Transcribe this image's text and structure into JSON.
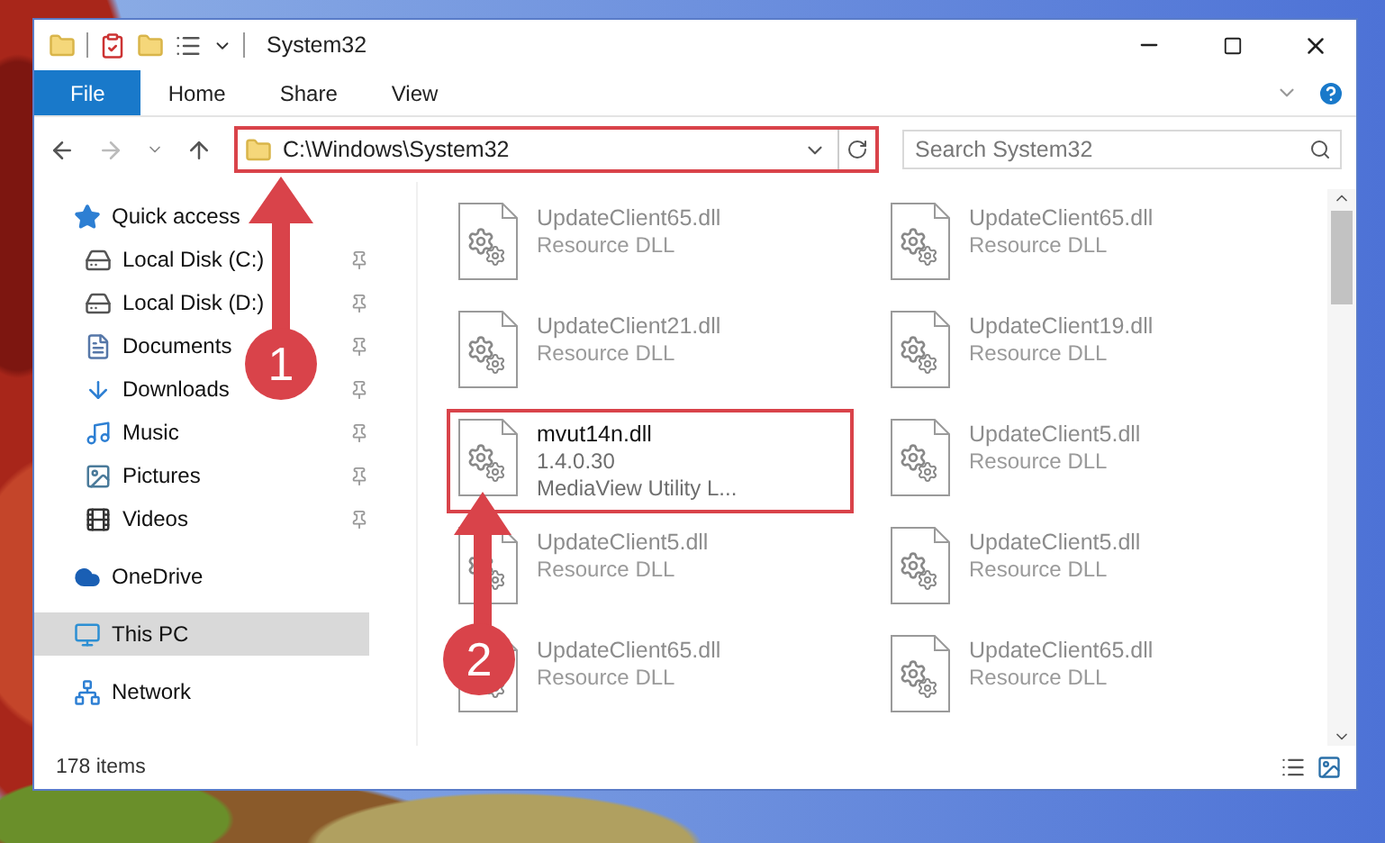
{
  "window": {
    "title": "System32"
  },
  "ribbon": {
    "tabs": [
      {
        "label": "File",
        "kind": "file",
        "selected": false
      },
      {
        "label": "Home",
        "kind": "tab",
        "selected": false
      },
      {
        "label": "Share",
        "kind": "tab",
        "selected": false
      },
      {
        "label": "View",
        "kind": "tab",
        "selected": false
      }
    ]
  },
  "address_bar": {
    "path": "C:\\Windows\\System32",
    "highlighted": true
  },
  "search": {
    "placeholder": "Search System32"
  },
  "navigation": {
    "items": [
      {
        "label": "Quick access",
        "kind": "star",
        "selected": false,
        "children": [
          {
            "label": "Local Disk (C:)",
            "kind": "drive",
            "pinned": true,
            "selected": false
          },
          {
            "label": "Local Disk (D:)",
            "kind": "drive",
            "pinned": true,
            "selected": false
          },
          {
            "label": "Documents",
            "kind": "documents",
            "pinned": true,
            "selected": false
          },
          {
            "label": "Downloads",
            "kind": "downloads",
            "pinned": true,
            "selected": false
          },
          {
            "label": "Music",
            "kind": "music",
            "pinned": true,
            "selected": false
          },
          {
            "label": "Pictures",
            "kind": "pictures",
            "pinned": true,
            "selected": false
          },
          {
            "label": "Videos",
            "kind": "videos",
            "pinned": true,
            "selected": false
          }
        ]
      },
      {
        "label": "OneDrive",
        "kind": "cloud",
        "selected": false
      },
      {
        "label": "This PC",
        "kind": "pc",
        "selected": true
      },
      {
        "label": "Network",
        "kind": "network",
        "selected": false
      }
    ]
  },
  "files": [
    {
      "name": "UpdateClient65.dll",
      "lines": [
        "Resource DLL"
      ],
      "faded": true,
      "highlighted": false
    },
    {
      "name": "UpdateClient65.dll",
      "lines": [
        "Resource DLL"
      ],
      "faded": true,
      "highlighted": false
    },
    {
      "name": "UpdateClient21.dll",
      "lines": [
        "Resource DLL"
      ],
      "faded": true,
      "highlighted": false
    },
    {
      "name": "UpdateClient19.dll",
      "lines": [
        "Resource DLL"
      ],
      "faded": true,
      "highlighted": false
    },
    {
      "name": "mvut14n.dll",
      "lines": [
        "1.4.0.30",
        "MediaView Utility L..."
      ],
      "faded": false,
      "highlighted": true
    },
    {
      "name": "UpdateClient5.dll",
      "lines": [
        "Resource DLL"
      ],
      "faded": true,
      "highlighted": false
    },
    {
      "name": "UpdateClient5.dll",
      "lines": [
        "Resource DLL"
      ],
      "faded": true,
      "highlighted": false
    },
    {
      "name": "UpdateClient5.dll",
      "lines": [
        "Resource DLL"
      ],
      "faded": true,
      "highlighted": false
    },
    {
      "name": "UpdateClient65.dll",
      "lines": [
        "Resource DLL"
      ],
      "faded": true,
      "highlighted": false
    },
    {
      "name": "UpdateClient65.dll",
      "lines": [
        "Resource DLL"
      ],
      "faded": true,
      "highlighted": false
    }
  ],
  "status_bar": {
    "item_count": "178 items"
  },
  "annotations": [
    {
      "number": "1"
    },
    {
      "number": "2"
    }
  ]
}
